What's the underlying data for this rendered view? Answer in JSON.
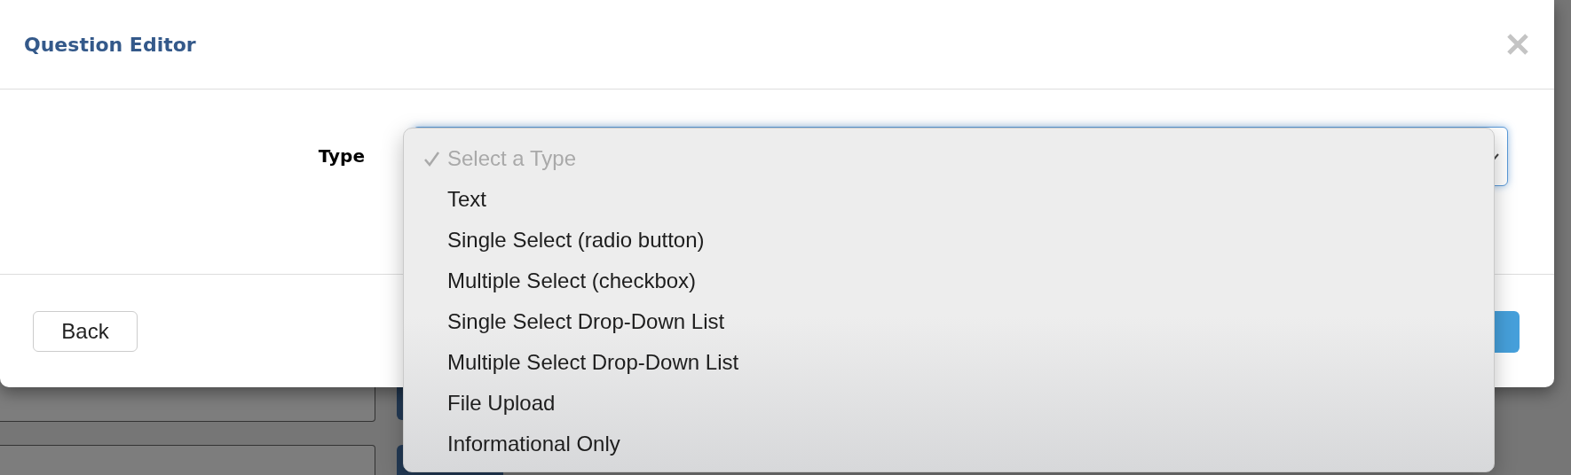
{
  "dialog": {
    "title": "Question Editor",
    "field": {
      "label": "Type"
    },
    "dropdown": {
      "options": [
        {
          "label": "Select a Type",
          "selected": true,
          "disabled": true
        },
        {
          "label": "Text",
          "selected": false,
          "disabled": false
        },
        {
          "label": "Single Select (radio button)",
          "selected": false,
          "disabled": false
        },
        {
          "label": "Multiple Select (checkbox)",
          "selected": false,
          "disabled": false
        },
        {
          "label": "Single Select Drop-Down List",
          "selected": false,
          "disabled": false
        },
        {
          "label": "Multiple Select Drop-Down List",
          "selected": false,
          "disabled": false
        },
        {
          "label": "File Upload",
          "selected": false,
          "disabled": false
        },
        {
          "label": "Informational Only",
          "selected": false,
          "disabled": false
        }
      ]
    },
    "buttons": [
      {
        "label": "Back",
        "kind": "secondary"
      },
      {
        "kind": "primary"
      }
    ]
  }
}
